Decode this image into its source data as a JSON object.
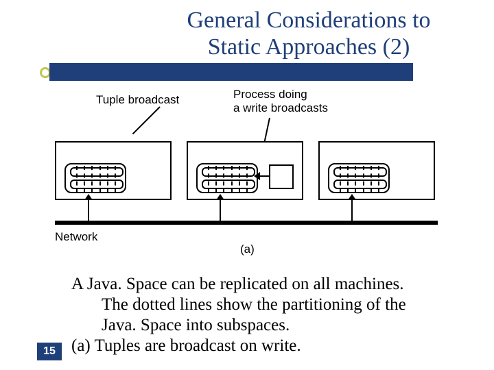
{
  "slide": {
    "title_line1": "General Considerations to",
    "title_line2": "Static Approaches (2)",
    "page_number": "15"
  },
  "figure": {
    "label_tuple_broadcast": "Tuple broadcast",
    "label_process_line1": "Process doing",
    "label_process_line2": "a write broadcasts",
    "label_network": "Network",
    "subfig": "(a)"
  },
  "body": {
    "line1": "A Java. Space can be replicated on all machines.",
    "line2": "The dotted lines show the partitioning of the",
    "line3": "Java. Space into subspaces.",
    "line4": "(a) Tuples are broadcast on write."
  }
}
